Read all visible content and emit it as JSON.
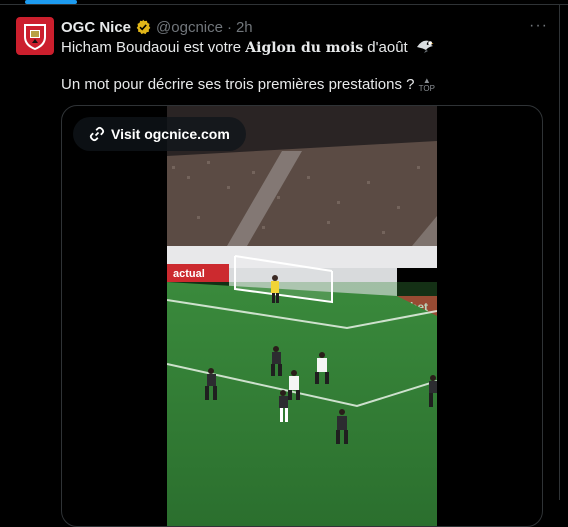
{
  "post": {
    "author_name": "OGC Nice",
    "handle": "@ogcnice",
    "separator": "·",
    "time": "2h",
    "more_label": "···",
    "text_prefix": "Hicham Boudaoui est votre ",
    "text_bold": "Aiglon du mois",
    "text_suffix": " d'août",
    "text_line2": "Un mot pour décrire ses trois premières prestations ?",
    "top_emoji_label": "TOP"
  },
  "media": {
    "link_label": "Visit ogcnice.com",
    "stadium_ad_left": "actual",
    "stadium_ad_right": "bet"
  },
  "colors": {
    "accent": "#1d9bf0",
    "club_red": "#cc1f2d",
    "pitch_green": "#2f7a34"
  },
  "icons": [
    "club-crest-icon",
    "verified-badge-icon",
    "eagle-emoji-icon",
    "top-emoji-icon",
    "link-icon",
    "more-icon"
  ]
}
